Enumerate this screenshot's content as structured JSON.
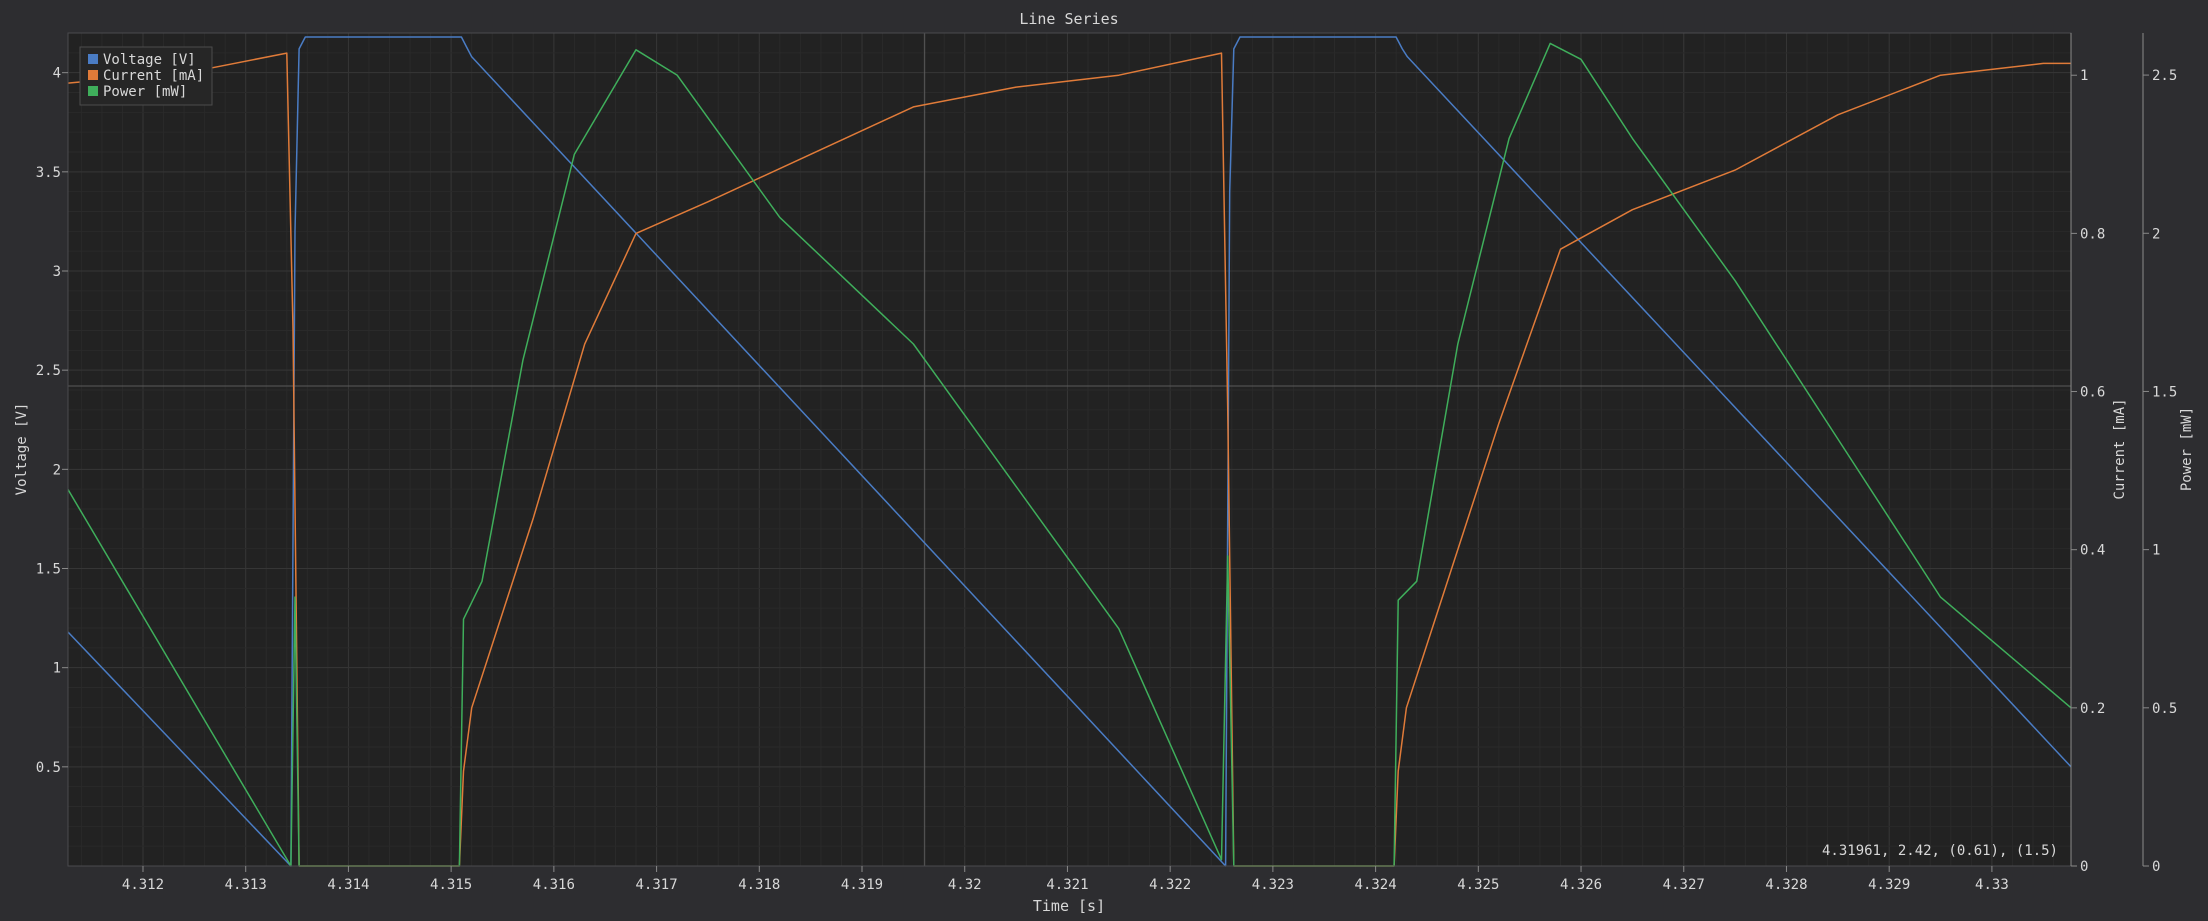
{
  "chart_data": {
    "type": "line",
    "title": "Line Series",
    "xlabel": "Time [s]",
    "xlim": [
      4.31127,
      4.33077
    ],
    "x_ticks": [
      "4.312",
      "4.313",
      "4.314",
      "4.315",
      "4.316",
      "4.317",
      "4.318",
      "4.319",
      "4.32",
      "4.321",
      "4.322",
      "4.323",
      "4.324",
      "4.325",
      "4.326",
      "4.327",
      "4.328",
      "4.329",
      "4.33"
    ],
    "grid": true,
    "legend_position": "top-left",
    "axes": {
      "y1": {
        "label": "Voltage [V]",
        "ylim": [
          0,
          4.2
        ],
        "ticks": [
          "0.5",
          "1",
          "1.5",
          "2",
          "2.5",
          "3",
          "3.5",
          "4"
        ]
      },
      "y2": {
        "label": "Current [mA]",
        "ylim": [
          0,
          1.0534
        ],
        "ticks": [
          "0",
          "0.2",
          "0.4",
          "0.6",
          "0.8",
          "1"
        ]
      },
      "y3": {
        "label": "Power [mW]",
        "ylim": [
          0,
          2.633
        ],
        "ticks": [
          "0",
          "0.5",
          "1",
          "1.5",
          "2",
          "2.5"
        ]
      }
    },
    "series": [
      {
        "name": "Voltage [V]",
        "axis": "y1",
        "color": "#4a7cc4",
        "points": [
          [
            4.31127,
            1.18
          ],
          [
            4.31344,
            0.0
          ],
          [
            4.31348,
            3.2
          ],
          [
            4.31352,
            4.12
          ],
          [
            4.31358,
            4.18
          ],
          [
            4.3151,
            4.18
          ],
          [
            4.31515,
            4.13
          ],
          [
            4.3152,
            4.08
          ],
          [
            4.32254,
            0.0
          ],
          [
            4.32258,
            3.4
          ],
          [
            4.32262,
            4.12
          ],
          [
            4.32268,
            4.18
          ],
          [
            4.3242,
            4.18
          ],
          [
            4.32426,
            4.12
          ],
          [
            4.32431,
            4.08
          ],
          [
            4.33077,
            0.5
          ]
        ]
      },
      {
        "name": "Current [mA]",
        "axis": "y2",
        "color": "#e07b39",
        "points": [
          [
            4.31127,
            0.99
          ],
          [
            4.3125,
            1.005
          ],
          [
            4.3134,
            1.028
          ],
          [
            4.31346,
            0.68
          ],
          [
            4.31352,
            0.0
          ],
          [
            4.31508,
            0.0
          ],
          [
            4.31512,
            0.12
          ],
          [
            4.3152,
            0.2
          ],
          [
            4.3153,
            0.24
          ],
          [
            4.3158,
            0.44
          ],
          [
            4.3163,
            0.66
          ],
          [
            4.3168,
            0.8
          ],
          [
            4.3175,
            0.84
          ],
          [
            4.3185,
            0.9
          ],
          [
            4.3195,
            0.96
          ],
          [
            4.3205,
            0.985
          ],
          [
            4.3215,
            1.0
          ],
          [
            4.3225,
            1.028
          ],
          [
            4.32256,
            0.58
          ],
          [
            4.32262,
            0.0
          ],
          [
            4.32418,
            0.0
          ],
          [
            4.32422,
            0.12
          ],
          [
            4.3243,
            0.2
          ],
          [
            4.3246,
            0.32
          ],
          [
            4.3252,
            0.56
          ],
          [
            4.3258,
            0.78
          ],
          [
            4.3265,
            0.83
          ],
          [
            4.3275,
            0.88
          ],
          [
            4.3285,
            0.95
          ],
          [
            4.3295,
            1.0
          ],
          [
            4.3305,
            1.015
          ],
          [
            4.33077,
            1.015
          ]
        ]
      },
      {
        "name": "Power [mW]",
        "axis": "y3",
        "color": "#3fae5b",
        "points": [
          [
            4.31127,
            1.19
          ],
          [
            4.31344,
            0.0
          ],
          [
            4.31348,
            0.85
          ],
          [
            4.31352,
            0.0
          ],
          [
            4.31508,
            0.0
          ],
          [
            4.31512,
            0.78
          ],
          [
            4.3153,
            0.9
          ],
          [
            4.3157,
            1.6
          ],
          [
            4.3162,
            2.25
          ],
          [
            4.3168,
            2.58
          ],
          [
            4.3172,
            2.5
          ],
          [
            4.3182,
            2.05
          ],
          [
            4.3195,
            1.65
          ],
          [
            4.3205,
            1.2
          ],
          [
            4.3215,
            0.75
          ],
          [
            4.3225,
            0.02
          ],
          [
            4.32256,
            0.98
          ],
          [
            4.32262,
            0.0
          ],
          [
            4.32418,
            0.0
          ],
          [
            4.32422,
            0.84
          ],
          [
            4.3244,
            0.9
          ],
          [
            4.3248,
            1.65
          ],
          [
            4.3253,
            2.3
          ],
          [
            4.3257,
            2.6
          ],
          [
            4.326,
            2.55
          ],
          [
            4.3265,
            2.3
          ],
          [
            4.3275,
            1.85
          ],
          [
            4.3285,
            1.35
          ],
          [
            4.3295,
            0.85
          ],
          [
            4.33077,
            0.5
          ]
        ]
      }
    ],
    "crosshair": {
      "x": 4.31961,
      "y1": 2.42,
      "y2": 0.61,
      "y3": 1.5
    },
    "cursor_readout": "4.31961, 2.42, (0.61), (1.5)"
  }
}
